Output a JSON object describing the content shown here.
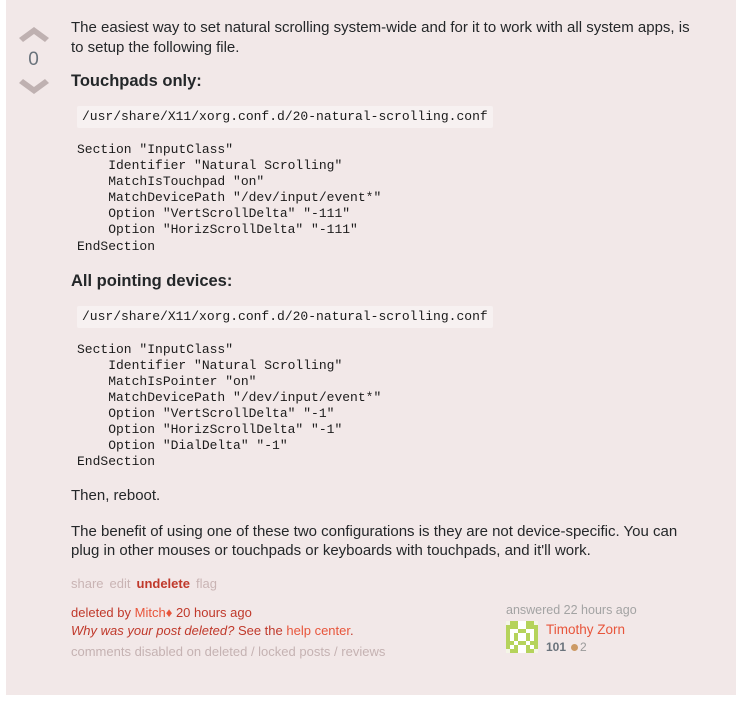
{
  "vote": {
    "up_icon": "chevron-up-icon",
    "down_icon": "chevron-down-icon",
    "count": "0"
  },
  "post": {
    "intro": "The easiest way to set natural scrolling system-wide and for it to work with all system apps, is to setup the following file.",
    "heading_touchpads": "Touchpads only:",
    "path_touchpads": "/usr/share/X11/xorg.conf.d/20-natural-scrolling.conf",
    "code_touchpads": "Section \"InputClass\"\n    Identifier \"Natural Scrolling\"\n    MatchIsTouchpad \"on\"\n    MatchDevicePath \"/dev/input/event*\"\n    Option \"VertScrollDelta\" \"-111\"\n    Option \"HorizScrollDelta\" \"-111\"\nEndSection",
    "heading_pointing": "All pointing devices:",
    "path_pointing": "/usr/share/X11/xorg.conf.d/20-natural-scrolling.conf",
    "code_pointing": "Section \"InputClass\"\n    Identifier \"Natural Scrolling\"\n    MatchIsPointer \"on\"\n    MatchDevicePath \"/dev/input/event*\"\n    Option \"VertScrollDelta\" \"-1\"\n    Option \"HorizScrollDelta\" \"-1\"\n    Option \"DialDelta\" \"-1\"\nEndSection",
    "reboot": "Then, reboot.",
    "benefit": "The benefit of using one of these two configurations is they are not device-specific. You can plug in other mouses or touchpads or keyboards with touchpads, and it'll work."
  },
  "menu": {
    "share": "share",
    "edit": "edit",
    "undelete": "undelete",
    "flag": "flag"
  },
  "deleted": {
    "prefix": "deleted by",
    "user": "Mitch",
    "diamond": "♦",
    "time": "20 hours ago",
    "why_question": "Why was your post deleted?",
    "see_the": "See the",
    "help_link": "help center",
    "period": ".",
    "comments_disabled": "comments disabled on deleted / locked posts / reviews"
  },
  "usercard": {
    "action_time": "answered 22 hours ago",
    "avatar_name": "identicon-avatar",
    "avatar_color": "#b5d35b",
    "display_name": "Timothy Zorn",
    "reputation": "101",
    "bronze_count": "2",
    "bronze_color": "#cc9a65"
  },
  "colors": {
    "deleted_bg": "#f2e8e8",
    "code_bg": "#f7f1f1",
    "link_red": "#e8553b",
    "undelete_red": "#c0392b"
  }
}
